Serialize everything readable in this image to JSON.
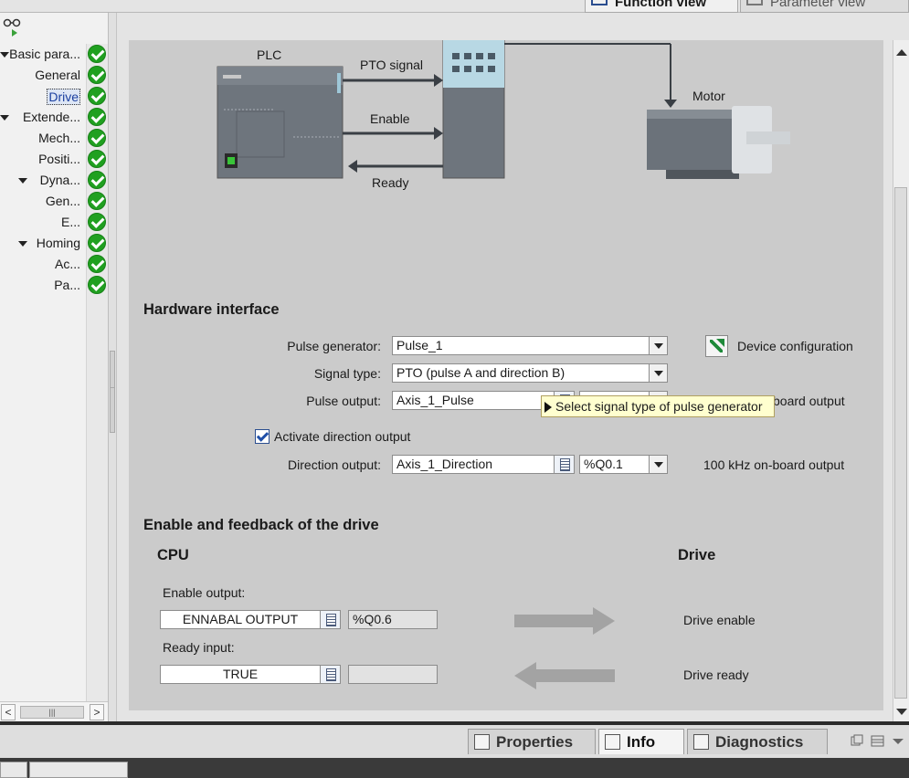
{
  "top_tabs": {
    "function_view": "Function view",
    "parameter_view": "Parameter view"
  },
  "tree": [
    {
      "label": "Basic para...",
      "level": 0,
      "expanded": true
    },
    {
      "label": "General",
      "level": 1
    },
    {
      "label": "Drive",
      "level": 1,
      "selected": true
    },
    {
      "label": "Extende...",
      "level": 0,
      "expanded": true
    },
    {
      "label": "Mech...",
      "level": 1
    },
    {
      "label": "Positi...",
      "level": 1
    },
    {
      "label": "Dyna...",
      "level": 1,
      "expanded": true
    },
    {
      "label": "Gen...",
      "level": 2
    },
    {
      "label": "E...",
      "level": 2
    },
    {
      "label": "Homing",
      "level": 1,
      "expanded": true
    },
    {
      "label": "Ac...",
      "level": 2
    },
    {
      "label": "Pa...",
      "level": 2
    }
  ],
  "diagram": {
    "plc_label": "PLC",
    "pto_signal": "PTO signal",
    "enable": "Enable",
    "ready": "Ready",
    "motor": "Motor"
  },
  "hardware_interface": {
    "heading": "Hardware interface",
    "pulse_generator_label": "Pulse generator:",
    "pulse_generator_value": "Pulse_1",
    "device_configuration": "Device configuration",
    "signal_type_label": "Signal type:",
    "signal_type_value": "PTO (pulse A and direction B)",
    "pulse_output_label": "Pulse output:",
    "pulse_output_value": "Axis_1_Pulse",
    "pulse_output_note": "board output",
    "tooltip": "Select signal type of pulse generator",
    "activate_direction_label": "Activate direction output",
    "activate_direction_checked": true,
    "direction_output_label": "Direction output:",
    "direction_output_value": "Axis_1_Direction",
    "direction_address": "%Q0.1",
    "direction_note": "100 kHz on-board output"
  },
  "enable_feedback": {
    "heading": "Enable and feedback of the drive",
    "cpu_heading": "CPU",
    "drive_heading": "Drive",
    "enable_output_label": "Enable output:",
    "enable_output_value": "ENNABAL OUTPUT",
    "enable_output_address": "%Q0.6",
    "drive_enable": "Drive enable",
    "ready_input_label": "Ready input:",
    "ready_input_value": "TRUE",
    "ready_input_address": "",
    "drive_ready": "Drive ready"
  },
  "bottom_tabs": {
    "properties": "Properties",
    "info": "Info",
    "diagnostics": "Diagnostics"
  },
  "colors": {
    "content_bg": "#cbcbcb",
    "check_green": "#20a020",
    "tooltip_bg": "#ffffcf"
  }
}
